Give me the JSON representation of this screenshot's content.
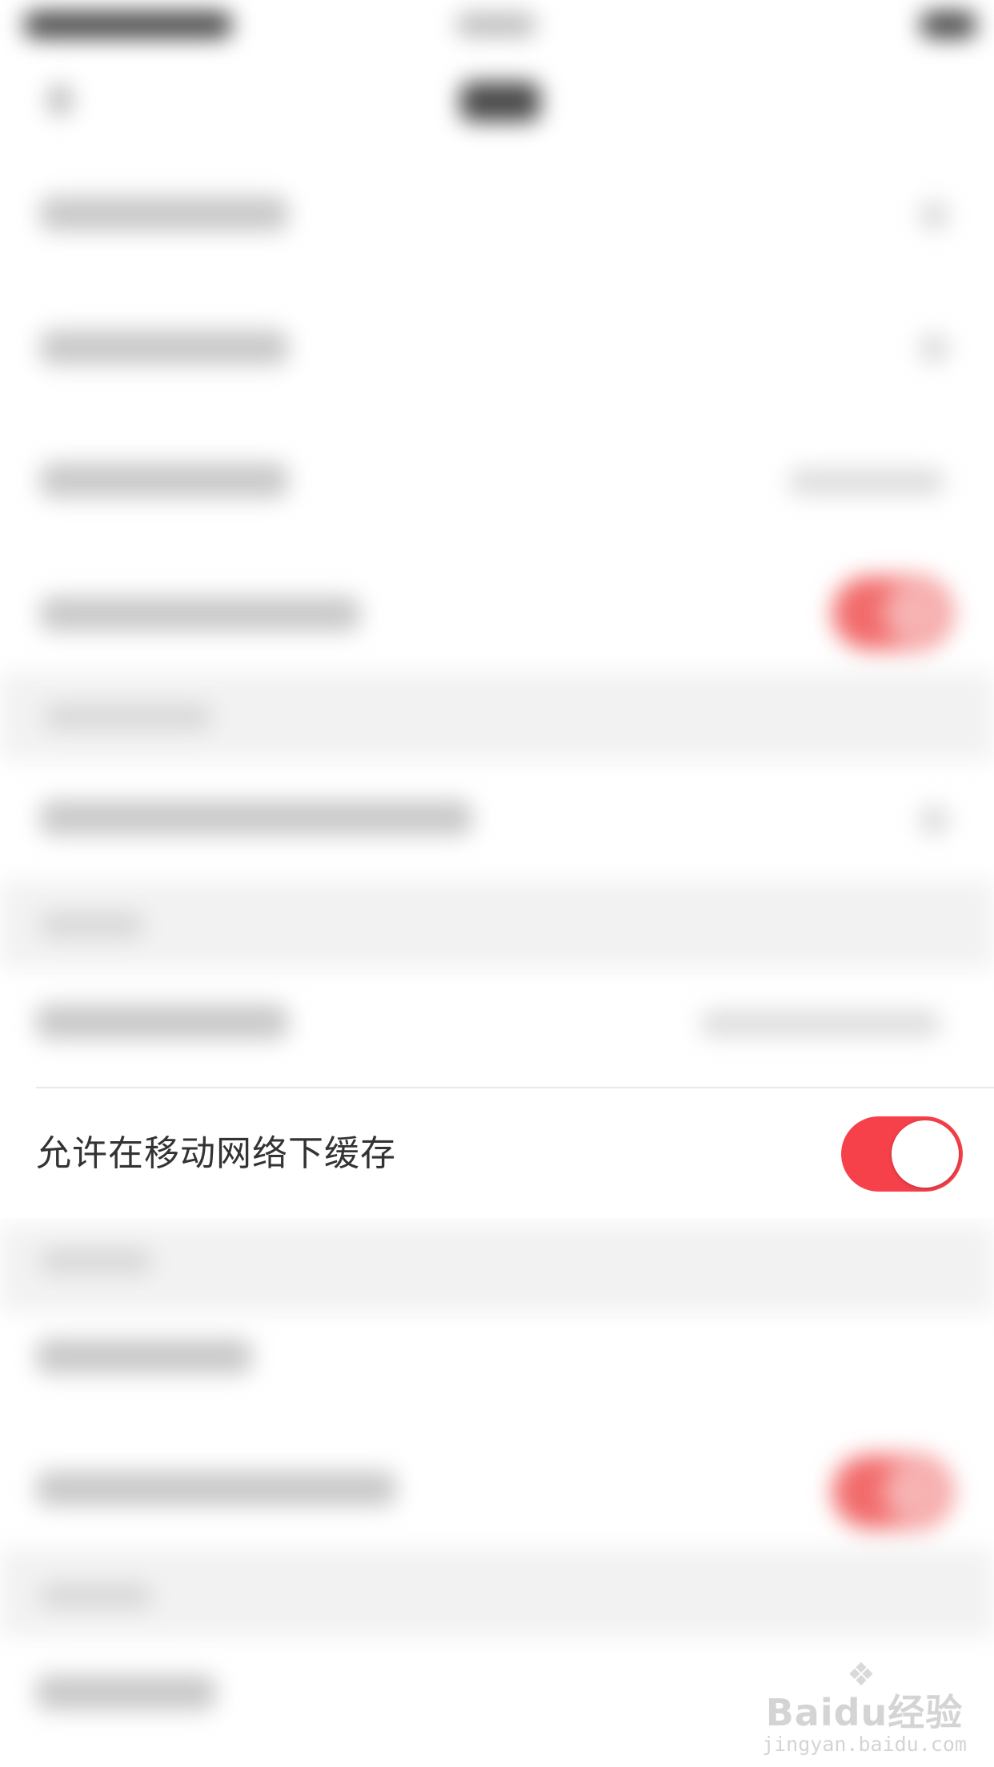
{
  "settings": {
    "mobile_cache": {
      "label": "允许在移动网络下缓存",
      "enabled": true,
      "accent_color": "#f6404a"
    }
  },
  "watermark": {
    "brand": "Baidu经验",
    "url": "jingyan.baidu.com",
    "icon": "paw-icon"
  }
}
